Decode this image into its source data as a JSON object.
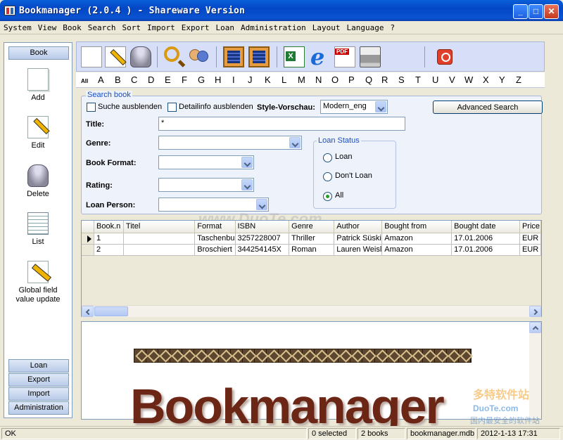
{
  "window": {
    "title": "Bookmanager (2.0.4 ) - Shareware Version"
  },
  "menu": [
    "System",
    "View",
    "Book",
    "Search",
    "Sort",
    "Import",
    "Export",
    "Loan",
    "Administration",
    "Layout",
    "Language",
    "?"
  ],
  "nav": {
    "header": "Book",
    "items": [
      {
        "label": "Add",
        "icon": "new-document-icon"
      },
      {
        "label": "Edit",
        "icon": "pencil-icon"
      },
      {
        "label": "Delete",
        "icon": "trash-icon"
      },
      {
        "label": "List",
        "icon": "list-icon"
      },
      {
        "label": "Global field value update",
        "icon": "global-edit-icon"
      }
    ],
    "bottom": [
      "Loan",
      "Export",
      "Import",
      "Administration"
    ]
  },
  "toolbar": {
    "icons": [
      "new-document-icon",
      "edit-pencil-icon",
      "trash-icon",
      "search-magnifier-icon",
      "users-icon",
      "form-view-icon",
      "form-view-alt-icon",
      "excel-export-icon",
      "internet-explorer-icon",
      "pdf-export-icon",
      "printer-icon",
      "power-exit-icon"
    ]
  },
  "alphabet": {
    "all": "All",
    "letters": [
      "A",
      "B",
      "C",
      "D",
      "E",
      "F",
      "G",
      "H",
      "I",
      "J",
      "K",
      "L",
      "M",
      "N",
      "O",
      "P",
      "Q",
      "R",
      "S",
      "T",
      "U",
      "V",
      "W",
      "X",
      "Y",
      "Z"
    ]
  },
  "search": {
    "legend": "Search book",
    "hide_search": "Suche ausblenden",
    "hide_detail": "Detailinfo ausblenden",
    "style_label": "Style-Vorschau:",
    "style_value": "Modern_eng",
    "advanced": "Advanced Search",
    "title_label": "Title:",
    "title_value": "*",
    "genre_label": "Genre:",
    "format_label": "Book Format:",
    "rating_label": "Rating:",
    "person_label": "Loan Person:",
    "loan_status": {
      "legend": "Loan Status",
      "options": [
        "Loan",
        "Don't Loan",
        "All"
      ],
      "selected": "All"
    }
  },
  "grid": {
    "columns": [
      "Book.n",
      "Titel",
      "Format",
      "ISBN",
      "Genre",
      "Author",
      "Bought from",
      "Bought date",
      "Price"
    ],
    "rows": [
      [
        "1",
        "",
        "Taschenbu",
        "3257228007",
        "Thriller",
        "Patrick Süski",
        "Amazon",
        "17.01.2006",
        "EUR"
      ],
      [
        "2",
        "",
        "Broschiert",
        "344254145X",
        "Roman",
        "Lauren Weisl",
        "Amazon",
        "17.01.2006",
        "EUR"
      ]
    ],
    "current_row": 1
  },
  "preview": {
    "logo_text": "Bookmanager"
  },
  "status": {
    "left": "OK",
    "selected": "0 selected",
    "count": "2 books",
    "file": "bookmanager.mdb",
    "datetime": "2012-1-13  17:31"
  },
  "watermark": {
    "center": "www.DuoTe.com",
    "corner": "多特软件站",
    "corner_url": "DuoTe.com",
    "corner_tag": "国内最安全的软件站"
  },
  "colors": {
    "title_bar": "#0347c6",
    "panel": "#eef2fb",
    "toolbar": "#d6dff7",
    "logo": "#6b2616",
    "accent_blue": "#1a4ec0"
  }
}
